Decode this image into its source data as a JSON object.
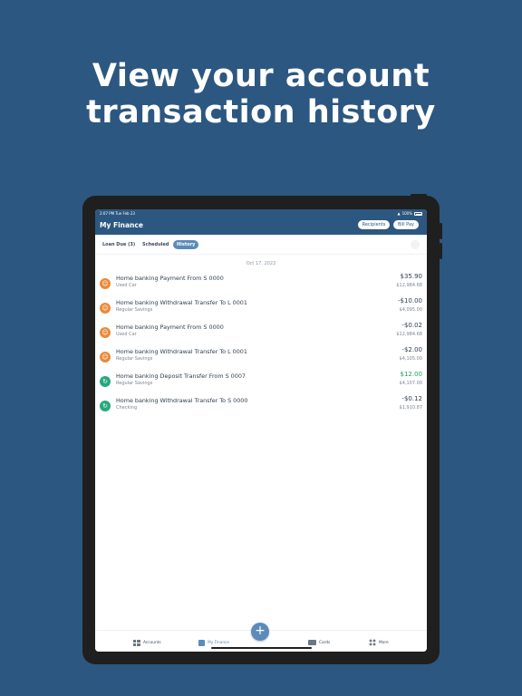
{
  "headline": {
    "line1": "View your account",
    "line2": "transaction history"
  },
  "status_bar": {
    "time": "2:07 PM  Tue Feb 23",
    "battery": "100%"
  },
  "app": {
    "title": "My Finance",
    "recipients_label": "Recipients",
    "bill_pay_label": "Bill Pay"
  },
  "tabs": {
    "loan_due": "Loan Due (3)",
    "scheduled": "Scheduled",
    "history": "History"
  },
  "date_header": "Oct 17, 2022",
  "transactions": [
    {
      "title": "Home banking Payment From S 0000",
      "account": "Used Car",
      "amount": "$35.90",
      "balance": "$12,984.68",
      "type": "credit-plain",
      "icon": "person-icon"
    },
    {
      "title": "Home banking Withdrawal Transfer To L 0001",
      "account": "Regular Savings",
      "amount": "-$10.00",
      "balance": "$4,095.00",
      "type": "debit",
      "icon": "person-icon"
    },
    {
      "title": "Home banking Payment From S 0000",
      "account": "Used Car",
      "amount": "-$0.02",
      "balance": "$12,984.68",
      "type": "debit",
      "icon": "person-icon"
    },
    {
      "title": "Home banking Withdrawal Transfer To L 0001",
      "account": "Regular Savings",
      "amount": "-$2.00",
      "balance": "$4,105.00",
      "type": "debit",
      "icon": "person-icon"
    },
    {
      "title": "Home banking Deposit Transfer From S 0007",
      "account": "Regular Savings",
      "amount": "$12.00",
      "balance": "$4,107.00",
      "type": "credit",
      "icon": "transfer-icon"
    },
    {
      "title": "Home banking Withdrawal Transfer To S 0000",
      "account": "Checking",
      "amount": "-$0.12",
      "balance": "$1,910.87",
      "type": "debit",
      "icon": "transfer-icon"
    }
  ],
  "bottom_nav": {
    "accounts": "Accounts",
    "my_finance": "My Finance",
    "cards": "Cards",
    "more": "More"
  },
  "colors": {
    "background": "#2c5780",
    "accent": "#5a8bbb",
    "credit": "#1f9e62",
    "person_icon": "#e98a3a",
    "transfer_icon": "#28a87a"
  }
}
